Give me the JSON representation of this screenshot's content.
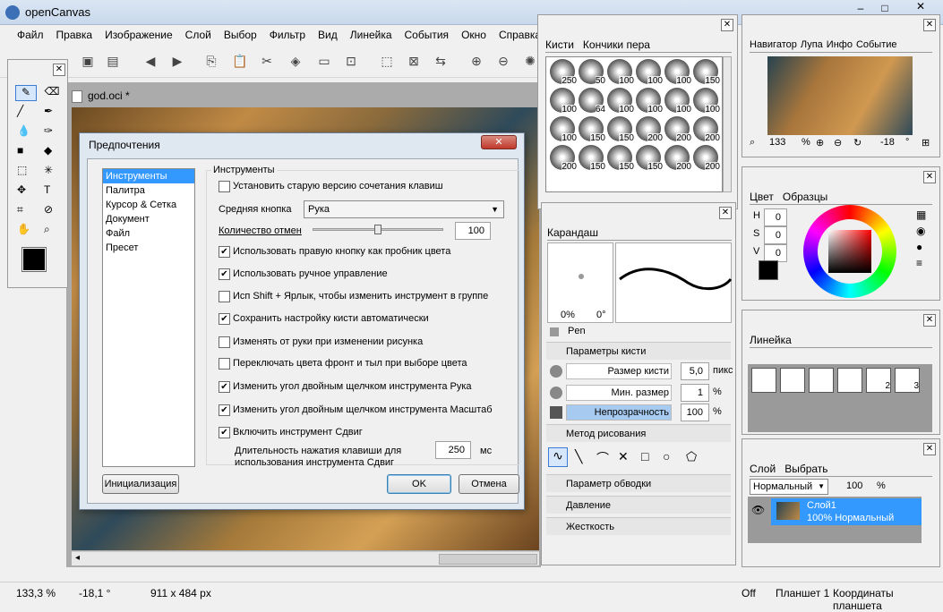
{
  "app": {
    "title": "openCanvas"
  },
  "menu": [
    "Файл",
    "Правка",
    "Изображение",
    "Слой",
    "Выбор",
    "Фильтр",
    "Вид",
    "Линейка",
    "События",
    "Окно",
    "Справка"
  ],
  "document": {
    "tab": "god.oci *"
  },
  "status": {
    "zoom": "133,3 %",
    "angle": "-18,1 °",
    "size": "911 x 484 px",
    "off": "Off",
    "tablet": "Планшет 1",
    "coords": "Координаты планшета"
  },
  "dialog": {
    "title": "Предпочтения",
    "categories": [
      "Инструменты",
      "Палитра",
      "Курсор & Сетка",
      "Документ",
      "Файл",
      "Пресет"
    ],
    "section": "Инструменты",
    "old_keys": "Установить старую версию сочетания клавиш",
    "middle_label": "Средняя кнопка",
    "middle_value": "Рука",
    "undo_label": "Количество отмен",
    "undo_value": "100",
    "options": [
      {
        "label": "Использовать правую кнопку как пробник цвета",
        "checked": true
      },
      {
        "label": "Использовать ручное управление",
        "checked": true
      },
      {
        "label": "Исп Shift + Ярлык, чтобы изменить инструмент в группе",
        "checked": false
      },
      {
        "label": "Сохранить настройку кисти автоматически",
        "checked": true
      },
      {
        "label": "Изменять от руки при изменении рисунка",
        "checked": false
      },
      {
        "label": "Переключать цвета фронт и тыл при выборе цвета",
        "checked": false
      },
      {
        "label": "Изменить угол двойным щелчком инструмента Рука",
        "checked": true
      },
      {
        "label": "Изменить угол двойным щелчком инструмента Масштаб",
        "checked": true
      },
      {
        "label": "Включить инструмент Сдвиг",
        "checked": true
      }
    ],
    "shift_label": "Длительность нажатия клавиши для использования инструмента Сдвиг",
    "shift_value": "250",
    "shift_unit": "мс",
    "init": "Инициализация",
    "ok": "OK",
    "cancel": "Отмена"
  },
  "brushes": {
    "tab1": "Кисти",
    "tab2": "Кончики пера",
    "sizes": [
      "250",
      "50",
      "100",
      "100",
      "100",
      "150",
      "100",
      "64",
      "100",
      "100",
      "100",
      "100",
      "100",
      "150",
      "150",
      "200",
      "200",
      "200",
      "200",
      "150",
      "150",
      "150",
      "200",
      "200"
    ]
  },
  "pencil": {
    "tab": "Карандаш",
    "pct": "0%",
    "deg": "0°",
    "name": "Pen",
    "params_head": "Параметры кисти",
    "size_label": "Размер кисти",
    "size_val": "5,0",
    "size_unit": "пикс",
    "min_label": "Мин. размер",
    "min_val": "1",
    "min_unit": "%",
    "op_label": "Непрозрачность",
    "op_val": "100",
    "op_unit": "%",
    "method_head": "Метод рисования",
    "stroke_head": "Параметр обводки",
    "pressure_head": "Давление",
    "hard_head": "Жесткость"
  },
  "navigator": {
    "tabs": [
      "Навигатор",
      "Лупа",
      "Инфо",
      "Событие"
    ],
    "zoom": "133",
    "pct": "%",
    "angle": "-18",
    "deg": "°"
  },
  "color": {
    "tabs": [
      "Цвет",
      "Образцы"
    ],
    "h": "0",
    "s": "0",
    "v": "0",
    "hl": "H",
    "sl": "S",
    "vl": "V"
  },
  "ruler": {
    "tab": "Линейка",
    "nums": [
      "2",
      "3"
    ]
  },
  "layer": {
    "tabs": [
      "Слой",
      "Выбрать"
    ],
    "mode": "Нормальный",
    "opacity": "100",
    "pct": "%",
    "name": "Слой1",
    "desc": "100% Нормальный"
  }
}
